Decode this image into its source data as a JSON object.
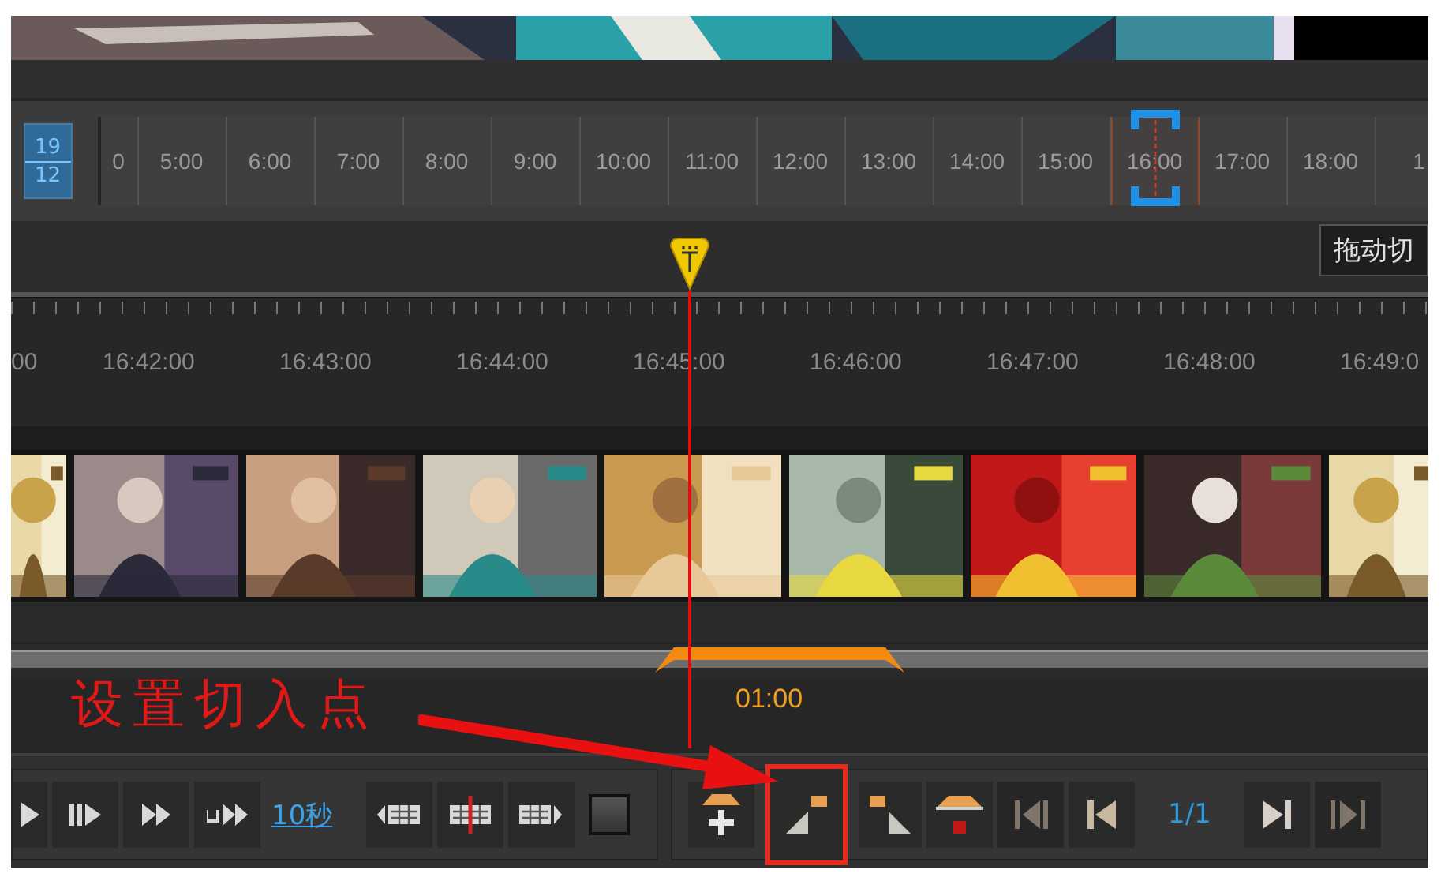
{
  "date_box": {
    "day": "19",
    "month": "12"
  },
  "hours": [
    {
      "label": "0",
      "selected": false
    },
    {
      "label": "5:00",
      "selected": false
    },
    {
      "label": "6:00",
      "selected": false
    },
    {
      "label": "7:00",
      "selected": false
    },
    {
      "label": "8:00",
      "selected": false
    },
    {
      "label": "9:00",
      "selected": false
    },
    {
      "label": "10:00",
      "selected": false
    },
    {
      "label": "11:00",
      "selected": false
    },
    {
      "label": "12:00",
      "selected": false
    },
    {
      "label": "13:00",
      "selected": false
    },
    {
      "label": "14:00",
      "selected": false
    },
    {
      "label": "15:00",
      "selected": false
    },
    {
      "label": "16:00",
      "selected": true
    },
    {
      "label": "17:00",
      "selected": false
    },
    {
      "label": "18:00",
      "selected": false
    },
    {
      "label": "1",
      "selected": false
    }
  ],
  "tooltip": "拖动切",
  "minute_labels": [
    "00",
    "16:42:00",
    "16:43:00",
    "16:44:00",
    "16:45:00",
    "16:46:00",
    "16:47:00",
    "16:48:00",
    "16:49:0"
  ],
  "range": {
    "label": "01:00"
  },
  "annotation": {
    "text": "设置切入点"
  },
  "left_controls": [
    {
      "kind": "play"
    },
    {
      "kind": "step"
    },
    {
      "kind": "ffwd"
    },
    {
      "kind": "skip"
    },
    {
      "kind": "link",
      "label": "10秒"
    },
    {
      "kind": "film-left"
    },
    {
      "kind": "film-split"
    },
    {
      "kind": "film-right"
    },
    {
      "kind": "stop"
    }
  ],
  "right_controls": [
    {
      "kind": "add-mark",
      "disabled": false,
      "highlighted": false
    },
    {
      "kind": "mark-in",
      "disabled": false,
      "highlighted": true
    },
    {
      "kind": "mark-out",
      "disabled": false,
      "highlighted": false
    },
    {
      "kind": "delete-mark",
      "disabled": false,
      "highlighted": false
    },
    {
      "kind": "first",
      "disabled": true,
      "highlighted": false
    },
    {
      "kind": "prev",
      "disabled": false,
      "highlighted": false
    },
    {
      "kind": "counter",
      "label": "1/1",
      "disabled": false,
      "highlighted": false
    },
    {
      "kind": "next",
      "disabled": false,
      "highlighted": false
    },
    {
      "kind": "last",
      "disabled": true,
      "highlighted": false
    }
  ]
}
